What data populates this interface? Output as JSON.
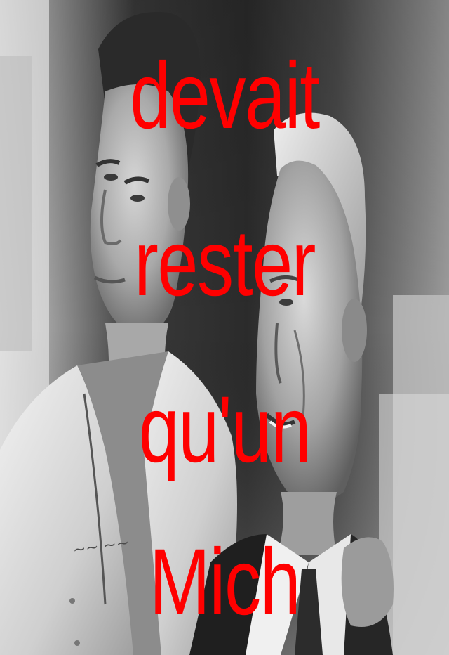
{
  "caption": {
    "line1": "devait",
    "line2": "rester",
    "line3": "qu'un",
    "line4": "Mich"
  },
  "colors": {
    "caption_text": "#ff0000",
    "photo_tone": "grayscale"
  }
}
